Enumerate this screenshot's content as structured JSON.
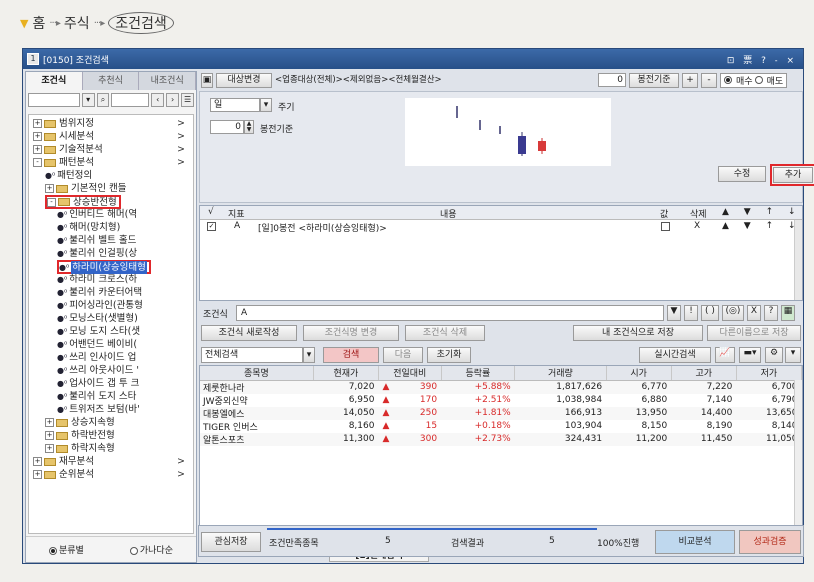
{
  "breadcrumb": {
    "home": "홈",
    "sep": "···▸",
    "stock": "주식",
    "current": "조건검색"
  },
  "window": {
    "title": "[0150] 조건검색",
    "controls": "⊡ 票 ? ˗ ×"
  },
  "left": {
    "tabs": [
      "조건식",
      "추천식",
      "내조건식"
    ],
    "tree": [
      {
        "label": "범위지정",
        "level": 0,
        "type": "folder",
        "pm": "+",
        "arrow": ">"
      },
      {
        "label": "시세분석",
        "level": 0,
        "type": "folder",
        "pm": "+",
        "arrow": ">"
      },
      {
        "label": "기술적분석",
        "level": 0,
        "type": "folder",
        "pm": "+",
        "arrow": ">"
      },
      {
        "label": "패턴분석",
        "level": 0,
        "type": "folder",
        "pm": "-",
        "arrow": ">"
      },
      {
        "label": "패턴정의",
        "level": 1,
        "type": "doc",
        "pm": "",
        "arrow": ""
      },
      {
        "label": "기본적인 캔들",
        "level": 1,
        "type": "folder",
        "pm": "+",
        "arrow": ""
      },
      {
        "label": "상승반전형",
        "level": 1,
        "type": "folder",
        "pm": "-",
        "arrow": ""
      },
      {
        "label": "인버티드 해머(역",
        "level": 2,
        "type": "doc",
        "pm": "",
        "arrow": ""
      },
      {
        "label": "해머(망치형)",
        "level": 2,
        "type": "doc",
        "pm": "",
        "arrow": ""
      },
      {
        "label": "불리쉬 벨트 홀드",
        "level": 2,
        "type": "doc",
        "pm": "",
        "arrow": ""
      },
      {
        "label": "불리쉬 인걸핑(상",
        "level": 2,
        "type": "doc",
        "pm": "",
        "arrow": ""
      },
      {
        "label": "하라미(상승잉태형",
        "level": 2,
        "type": "doc",
        "pm": "",
        "arrow": ""
      },
      {
        "label": "하라미 크로스(하",
        "level": 2,
        "type": "doc",
        "pm": "",
        "arrow": ""
      },
      {
        "label": "불리쉬 카운터어택",
        "level": 2,
        "type": "doc",
        "pm": "",
        "arrow": ""
      },
      {
        "label": "피어싱라인(관통형",
        "level": 2,
        "type": "doc",
        "pm": "",
        "arrow": ""
      },
      {
        "label": "모닝스타(샛별형)",
        "level": 2,
        "type": "doc",
        "pm": "",
        "arrow": ""
      },
      {
        "label": "모닝 도지 스타(샛",
        "level": 2,
        "type": "doc",
        "pm": "",
        "arrow": ""
      },
      {
        "label": "어밴던드 베이비(",
        "level": 2,
        "type": "doc",
        "pm": "",
        "arrow": ""
      },
      {
        "label": "쓰리 인사이드 업",
        "level": 2,
        "type": "doc",
        "pm": "",
        "arrow": ""
      },
      {
        "label": "쓰리 아웃사이드 '",
        "level": 2,
        "type": "doc",
        "pm": "",
        "arrow": ""
      },
      {
        "label": "업사이드 갭 투 크",
        "level": 2,
        "type": "doc",
        "pm": "",
        "arrow": ""
      },
      {
        "label": "불리쉬 도지 스타",
        "level": 2,
        "type": "doc",
        "pm": "",
        "arrow": ""
      },
      {
        "label": "트위저즈 보텀(바'",
        "level": 2,
        "type": "doc",
        "pm": "",
        "arrow": ""
      },
      {
        "label": "상승지속형",
        "level": 1,
        "type": "folder",
        "pm": "+",
        "arrow": ""
      },
      {
        "label": "하락반전형",
        "level": 1,
        "type": "folder",
        "pm": "+",
        "arrow": ""
      },
      {
        "label": "하락지속형",
        "level": 1,
        "type": "folder",
        "pm": "+",
        "arrow": ""
      },
      {
        "label": "재무분석",
        "level": 0,
        "type": "folder",
        "pm": "+",
        "arrow": ">"
      },
      {
        "label": "순위분석",
        "level": 0,
        "type": "folder",
        "pm": "+",
        "arrow": ">"
      }
    ],
    "footer": {
      "opt1": "분류별",
      "opt2": "가나다순"
    }
  },
  "right": {
    "target_btn": "대상변경",
    "target_text": "<업종대상(전체)><제외없음><전체월결산>",
    "bong_value": "0",
    "bong_btn": "봉전기준",
    "plus": "+",
    "minus": "-",
    "buy": "매수",
    "sell": "매도",
    "period_value": "일",
    "period_label": "주기",
    "offset_value": "0",
    "offset_label": "봉전기준",
    "edit_btn": "수정",
    "add_btn": "추가",
    "cond_headers": {
      "check": "√",
      "index": "지표",
      "content": "내용",
      "value": "값",
      "delete": "삭제",
      "arrows": "▲ ▼ ↑ ↓"
    },
    "cond_row": {
      "id": "A",
      "content": "[일]0봉전 <하라미(상승잉태형)>",
      "del": "X"
    },
    "expr_label": "조건식",
    "expr_value": "A",
    "expr_tools": [
      "▼",
      "!",
      "( )",
      "(◎)",
      "X",
      "?"
    ],
    "btn_new": "조건식 새로작성",
    "btn_rename": "조건식명 변경",
    "btn_delete": "조건식 삭제",
    "btn_save": "내 조건식으로 저장",
    "btn_saveas": "다른이름으로 저장",
    "search_scope": "전체검색",
    "btn_search": "검색",
    "btn_next": "다음",
    "btn_reset": "초기화",
    "btn_realtime": "실시간검색",
    "grid_headers": [
      "종목명",
      "현재가",
      "전일대비",
      "등락률",
      "거래량",
      "시가",
      "고가",
      "저가"
    ],
    "rows": [
      [
        "제룻한나라",
        "7,020",
        "▲",
        "390",
        "+5.88%",
        "1,817,626",
        "6,770",
        "7,220",
        "6,700"
      ],
      [
        "JW중외신약",
        "6,950",
        "▲",
        "170",
        "+2.51%",
        "1,038,984",
        "6,880",
        "7,140",
        "6,790"
      ],
      [
        "대봉엘에스",
        "14,050",
        "▲",
        "250",
        "+1.81%",
        "166,913",
        "13,950",
        "14,400",
        "13,650"
      ],
      [
        "TIGER 인버스",
        "8,160",
        "▲",
        "15",
        "+0.18%",
        "103,904",
        "8,150",
        "8,190",
        "8,140"
      ],
      [
        "알톤스포츠",
        "11,300",
        "▲",
        "300",
        "+2.73%",
        "324,431",
        "11,200",
        "11,450",
        "11,050"
      ]
    ],
    "status_tab": "[1]전체검색"
  },
  "bottom": {
    "save_interest": "관심저장",
    "satisfy_label": "조건만족종목",
    "satisfy_count": "5",
    "result_label": "검색결과",
    "result_count": "5",
    "progress_label": "100%진행",
    "progress_value": 1.0,
    "compare": "비교분석",
    "performance": "성과검증"
  },
  "colors": {
    "accent_red": "#e0282c",
    "rise": "#d82a2a",
    "title_bar": "#2f5c98",
    "selection": "#3264c8"
  }
}
